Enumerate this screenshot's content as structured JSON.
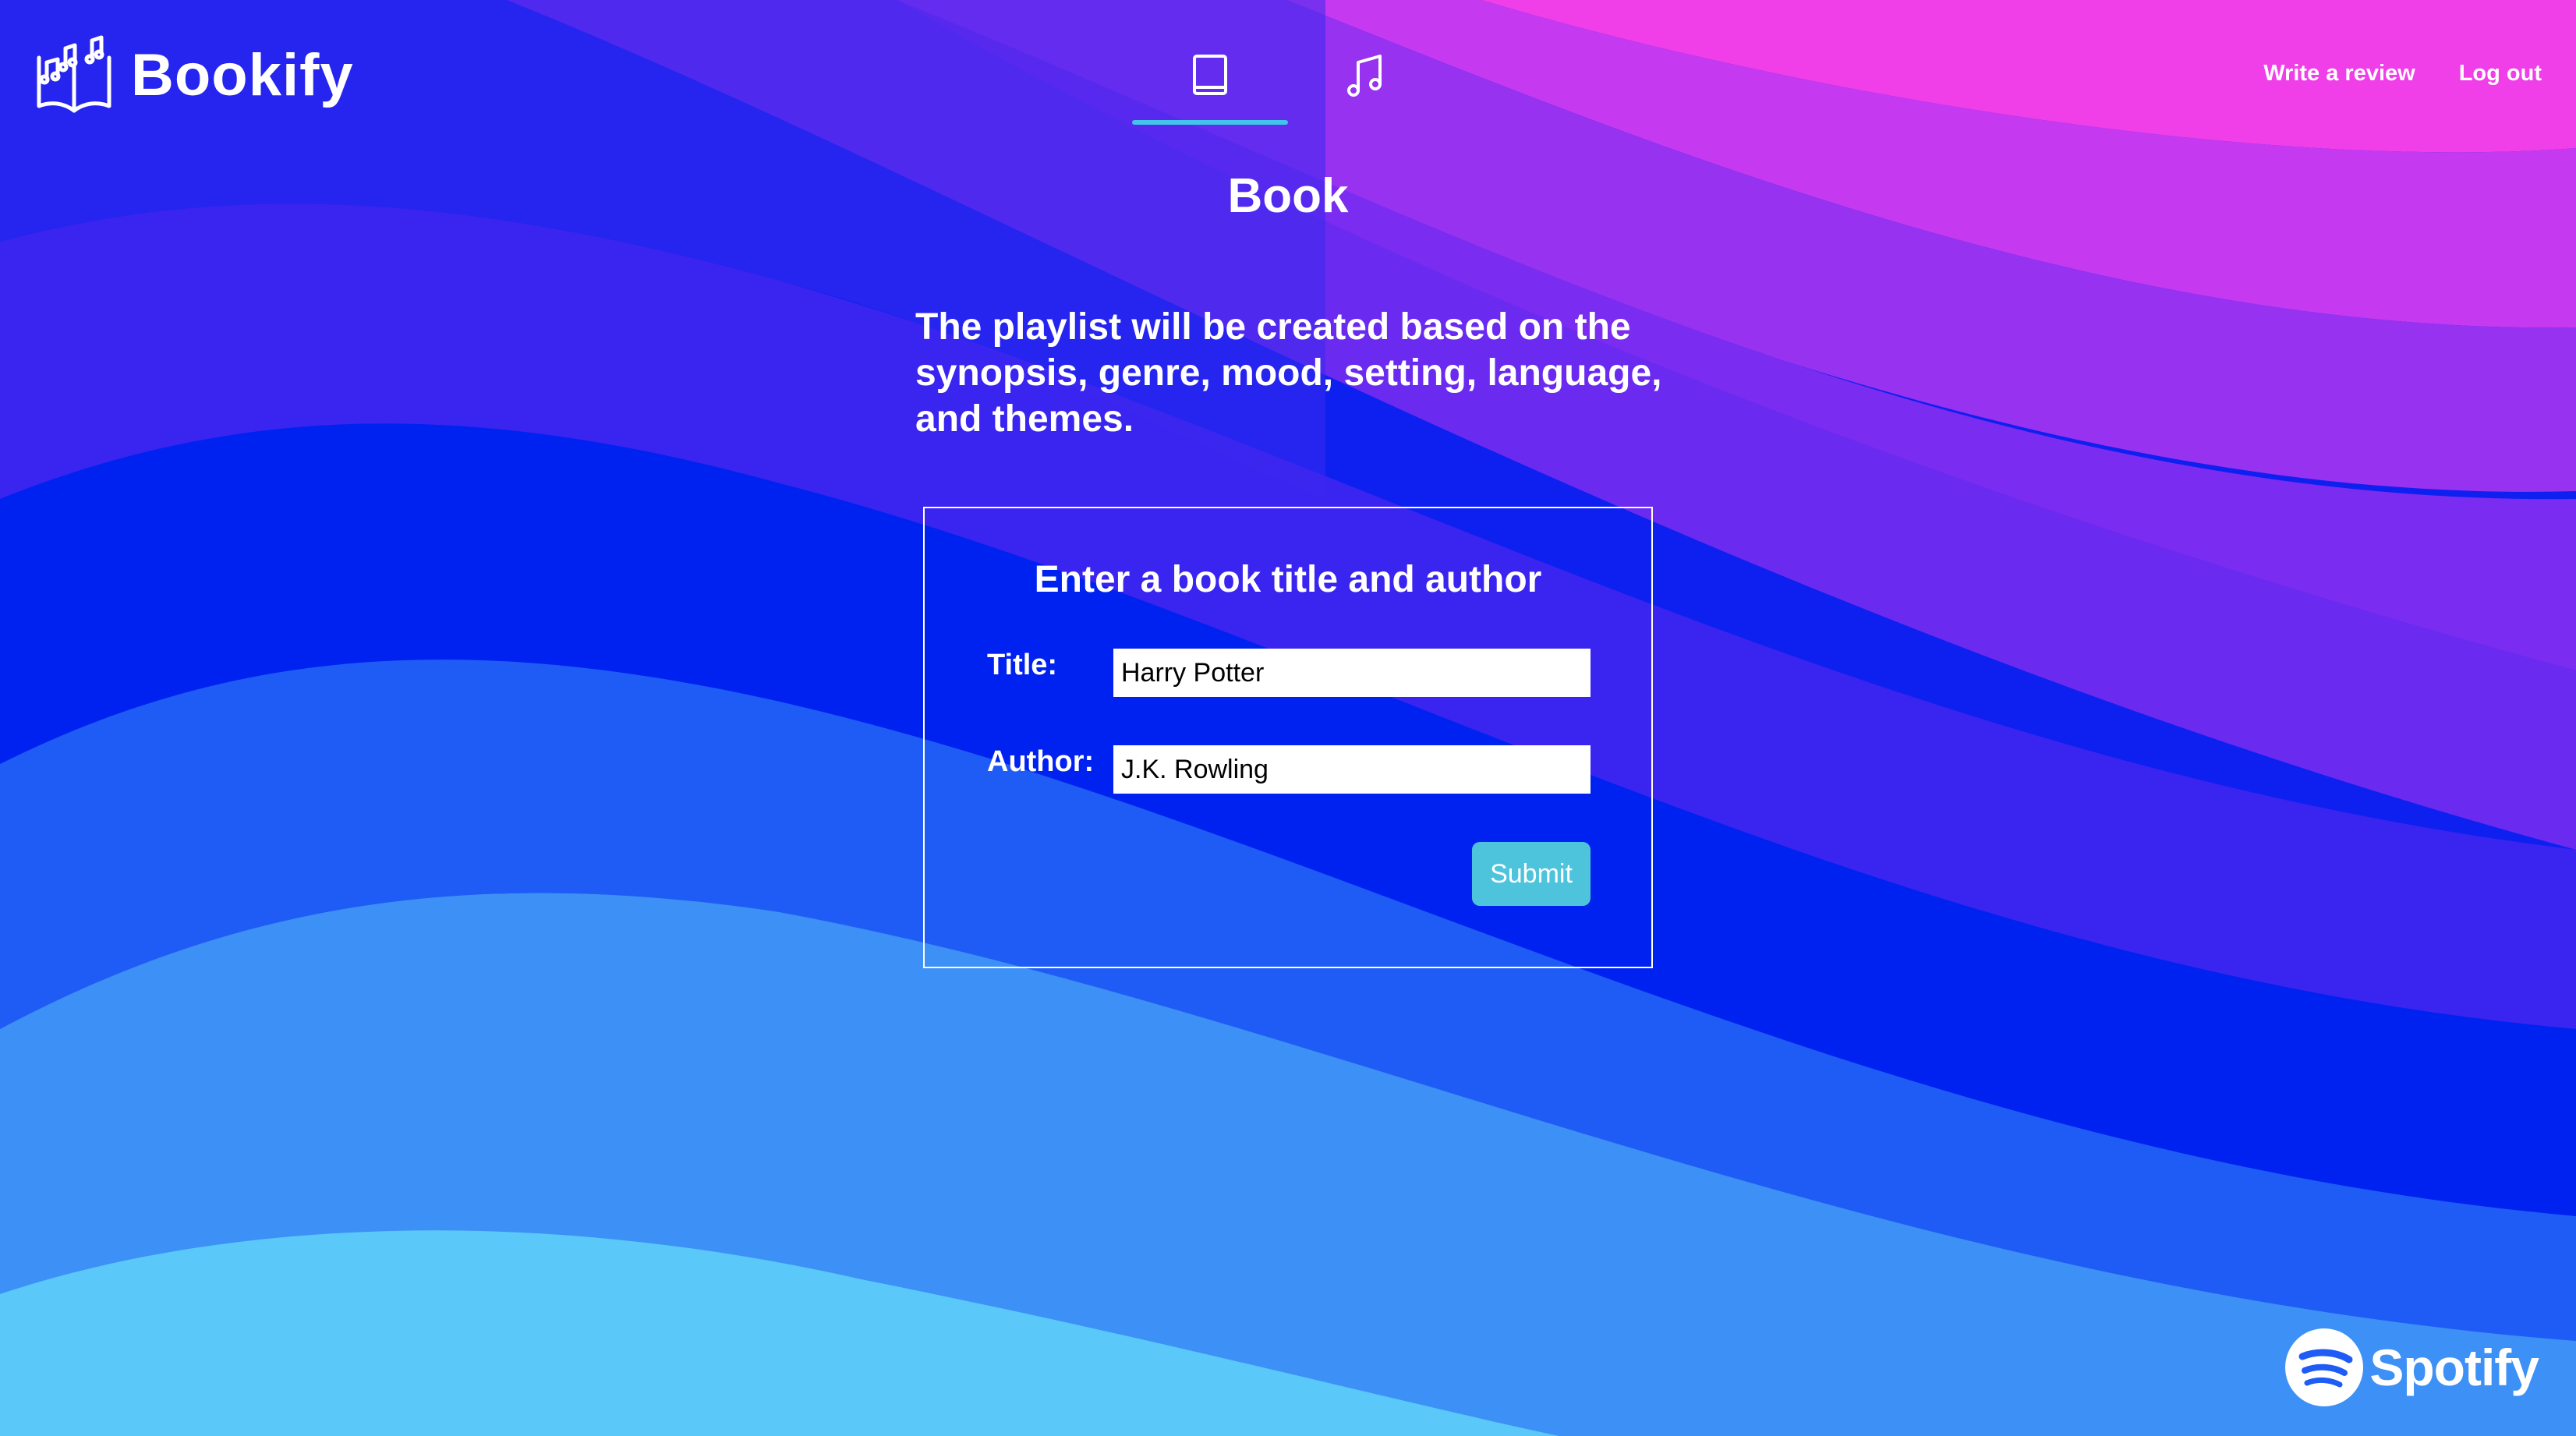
{
  "app": {
    "title": "Bookify"
  },
  "header": {
    "tabs": [
      {
        "name": "book",
        "icon": "book-icon",
        "active": true
      },
      {
        "name": "music",
        "icon": "music-note-icon",
        "active": false
      }
    ],
    "links": {
      "write_review": "Write a review",
      "log_out": "Log out"
    }
  },
  "page": {
    "title": "Book",
    "description": "The playlist will be created based on the synopsis, genre, mood, setting, language, and themes."
  },
  "form": {
    "heading": "Enter a book title and author",
    "title_label": "Title:",
    "title_value": "Harry Potter",
    "author_label": "Author:",
    "author_value": "J.K. Rowling",
    "submit_label": "Submit"
  },
  "footer": {
    "brand": "Spotify"
  },
  "colors": {
    "accent": "#43c3ea",
    "submit": "#4ec4dc",
    "wave_top": "#f03ee8",
    "wave_mid": "#0022f0",
    "wave_bottom": "#5bc8fa"
  }
}
